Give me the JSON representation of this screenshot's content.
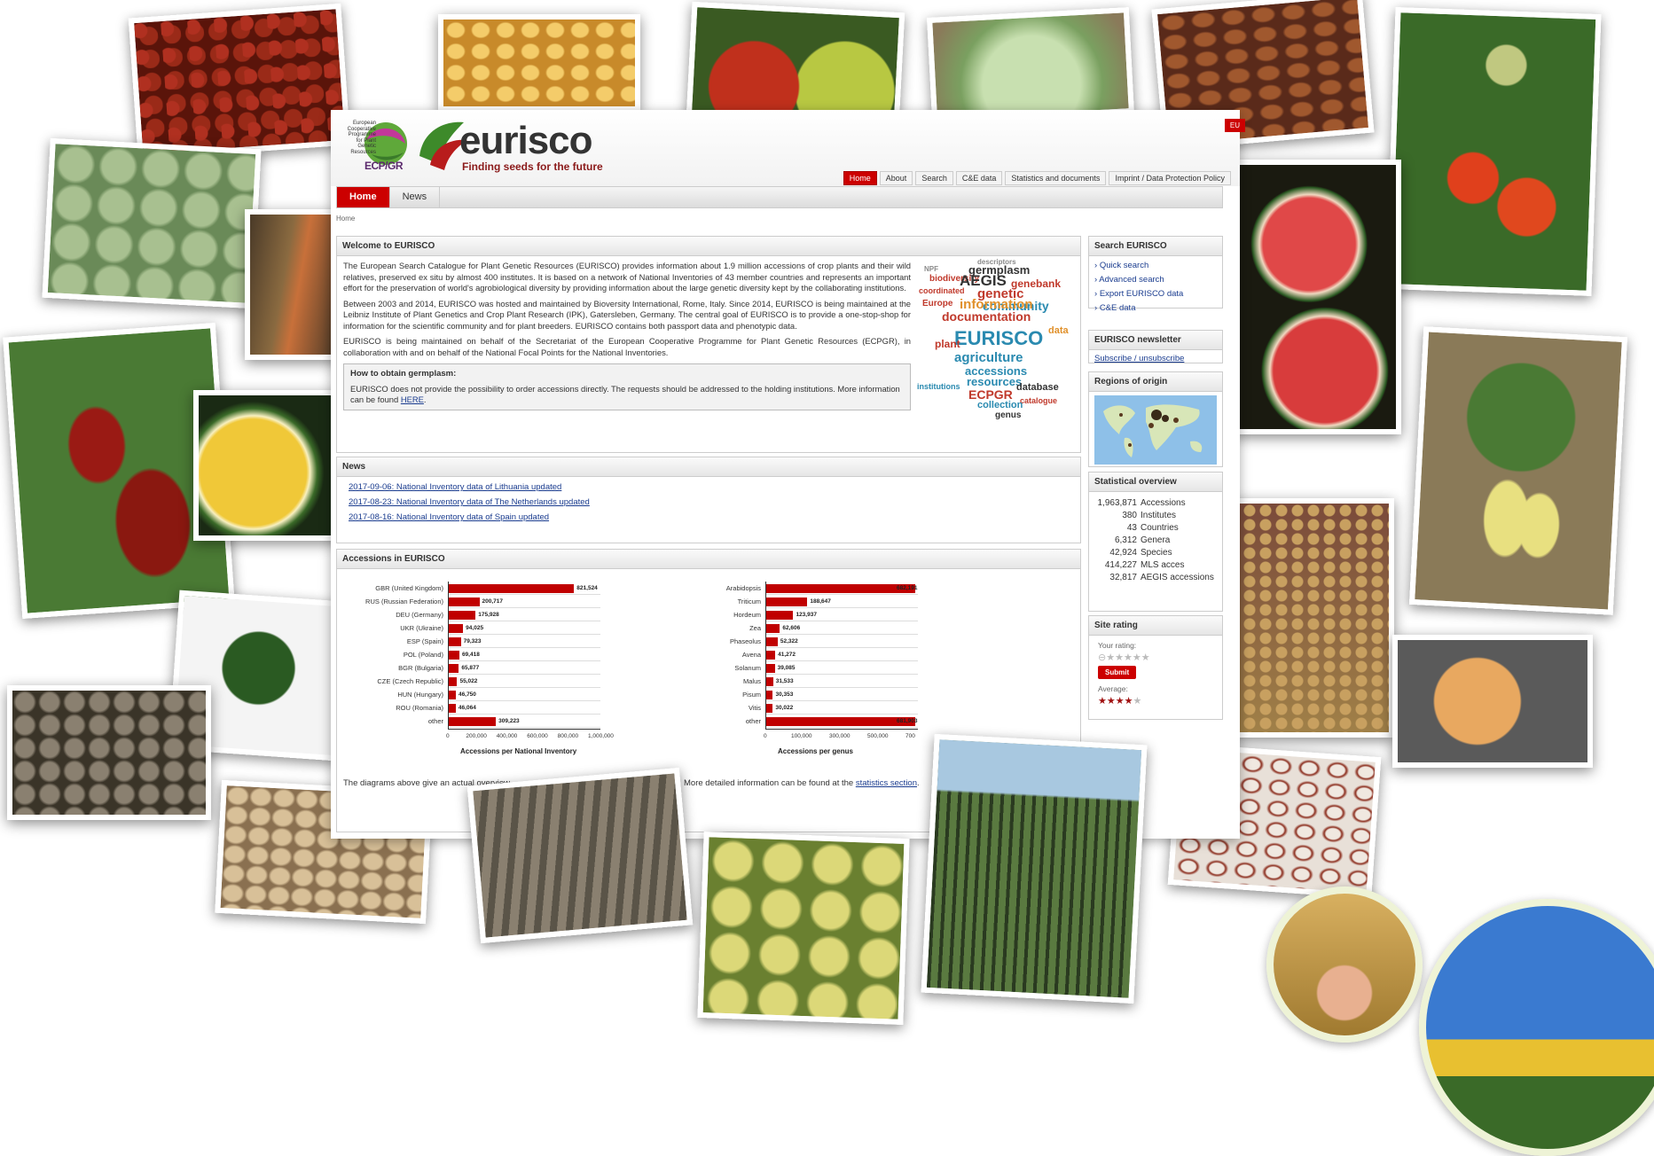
{
  "site": {
    "lang_tab": "EU",
    "ecpgr_lines": [
      "European",
      "Cooperative",
      "Programme",
      "for Plant",
      "Genetic",
      "Resources"
    ],
    "ecpgr_name": "ECP/GR",
    "brand": "eurisco",
    "tagline": "Finding seeds for the future",
    "top_nav": [
      "Home",
      "About",
      "Search",
      "C&E data",
      "Statistics and documents",
      "Imprint / Data Protection Policy"
    ],
    "main_nav": [
      "Home",
      "News"
    ],
    "breadcrumb": "Home"
  },
  "welcome": {
    "title": "Welcome to EURISCO",
    "p1": "The European Search Catalogue for Plant Genetic Resources (EURISCO) provides information about 1.9 million accessions of crop plants and their wild relatives, preserved ex situ by almost 400 institutes. It is based on a network of National Inventories of 43 member countries and represents an important effort for the preservation of world's agrobiological diversity by providing information about the large genetic diversity kept by the collaborating institutions.",
    "p2": "Between 2003 and 2014, EURISCO was hosted and maintained by Bioversity International, Rome, Italy. Since 2014, EURISCO is being maintained at the Leibniz Institute of Plant Genetics and Crop Plant Research (IPK), Gatersleben, Germany. The central goal of EURISCO is to provide a one-stop-shop for information for the scientific community and for plant breeders. EURISCO contains both passport data and phenotypic data.",
    "p3": "EURISCO is being maintained on behalf of the Secretariat of the European Cooperative Programme for Plant Genetic Resources (ECPGR), in collaboration with and on behalf of the National Focal Points for the National Inventories.",
    "howto_title": "How to obtain germplasm:",
    "howto_text": "EURISCO does not provide the possibility to order accessions directly. The requests should be addressed to the holding institutions. More information can be found",
    "howto_link": "HERE",
    "cloud_words": [
      "descriptors",
      "NPF",
      "germplasm",
      "biodiversity",
      "AEGIS",
      "genebank",
      "genetic",
      "community",
      "coordinated",
      "Europe",
      "information",
      "documentation",
      "EURISCO",
      "agriculture",
      "accessions",
      "resources",
      "database",
      "ECPGR",
      "catalogue",
      "collection",
      "genus",
      "institutions",
      "plant",
      "data"
    ]
  },
  "news": {
    "title": "News",
    "items": [
      "2017-09-06: National Inventory data of Lithuania updated",
      "2017-08-23: National Inventory data of The Netherlands updated",
      "2017-08-16: National Inventory data of Spain updated"
    ]
  },
  "accessions": {
    "title": "Accessions in EURISCO",
    "footer_start": "The diagrams above give an actual overview",
    "footer_end": "More detailed information can be found at the",
    "footer_link": "statistics section",
    "footer_period": "."
  },
  "chart_data": [
    {
      "type": "bar",
      "orientation": "horizontal",
      "categories": [
        "GBR (United Kingdom)",
        "RUS (Russian Federation)",
        "DEU (Germany)",
        "UKR (Ukraine)",
        "ESP (Spain)",
        "POL (Poland)",
        "BGR (Bulgaria)",
        "CZE (Czech Republic)",
        "HUN (Hungary)",
        "ROU (Romania)",
        "other"
      ],
      "values": [
        821524,
        200717,
        175928,
        94025,
        79323,
        69418,
        65877,
        55022,
        46750,
        46064,
        309223
      ],
      "value_labels": [
        "821,524",
        "200,717",
        "175,928",
        "94,025",
        "79,323",
        "69,418",
        "65,877",
        "55,022",
        "46,750",
        "46,064",
        "309,223"
      ],
      "xlabel": "Accessions per National Inventory",
      "xlim": [
        0,
        1000000
      ],
      "xticks": [
        "0",
        "200,000",
        "400,000",
        "600,000",
        "800,000",
        "1,000,000"
      ],
      "color": "#c00000"
    },
    {
      "type": "bar",
      "orientation": "horizontal",
      "categories": [
        "Arabidopsis",
        "Triticum",
        "Hordeum",
        "Zea",
        "Phaseolus",
        "Avena",
        "Solanum",
        "Malus",
        "Pisum",
        "Vitis",
        "other"
      ],
      "values": [
        682191,
        188647,
        123937,
        62606,
        52322,
        41272,
        39085,
        31533,
        30353,
        30022,
        681903
      ],
      "value_labels": [
        "682,191",
        "188,647",
        "123,937",
        "62,606",
        "52,322",
        "41,272",
        "39,085",
        "31,533",
        "30,353",
        "30,022",
        "681,903"
      ],
      "xlabel": "Accessions per genus",
      "xlim": [
        0,
        700000
      ],
      "xticks": [
        "0",
        "100,000",
        "300,000",
        "500,000",
        "700"
      ],
      "color": "#c00000"
    }
  ],
  "sidebar": {
    "search_title": "Search EURISCO",
    "search_links": [
      "Quick search",
      "Advanced search",
      "Export EURISCO data",
      "C&E data"
    ],
    "newsletter_title": "EURISCO newsletter",
    "newsletter_link": "Subscribe / unsubscribe",
    "regions_title": "Regions of origin",
    "stats_title": "Statistical overview",
    "stats": [
      {
        "n": "1,963,871",
        "label": "Accessions"
      },
      {
        "n": "380",
        "label": "Institutes"
      },
      {
        "n": "43",
        "label": "Countries"
      },
      {
        "n": "6,312",
        "label": "Genera"
      },
      {
        "n": "42,924",
        "label": "Species"
      },
      {
        "n": "414,227",
        "label": "MLS acces"
      },
      {
        "n": "32,817",
        "label": "AEGIS accessions"
      }
    ],
    "rating_title": "Site rating",
    "your_rating": "Your rating:",
    "submit": "Submit",
    "average": "Average:",
    "average_stars": 4,
    "max_stars": 5
  },
  "photos": [
    {
      "name": "red-maize-kernels-photo",
      "color": "#7a1f10"
    },
    {
      "name": "yellow-maize-kernels-photo",
      "color": "#e8b64a"
    },
    {
      "name": "apples-photo",
      "color": "#8ea83a"
    },
    {
      "name": "cabbage-photo",
      "color": "#9fc08a"
    },
    {
      "name": "beans-photo",
      "color": "#8b4a2a"
    },
    {
      "name": "tomato-plant-photo",
      "color": "#3e6b2a"
    },
    {
      "name": "kohlrabi-photo",
      "color": "#8eac74"
    },
    {
      "name": "carrot-roots-photo",
      "color": "#6a5a3a"
    },
    {
      "name": "watermelon-photo",
      "color": "#b83a3a"
    },
    {
      "name": "red-pepper-photo",
      "color": "#8a2a22"
    },
    {
      "name": "yellow-watermelon-photo",
      "color": "#d9b52a"
    },
    {
      "name": "yellow-pepper-plant-photo",
      "color": "#4f7a32"
    },
    {
      "name": "seedling-photo",
      "color": "#f0f0f0"
    },
    {
      "name": "peanut-plant-photo",
      "color": "#9a7a4a"
    },
    {
      "name": "pumpkin-photo",
      "color": "#6a6a6a"
    },
    {
      "name": "grey-seeds-photo",
      "color": "#7a7060"
    },
    {
      "name": "beige-seeds-photo",
      "color": "#c8b088"
    },
    {
      "name": "parsnip-photo",
      "color": "#7a7468"
    },
    {
      "name": "melon-photo",
      "color": "#8aa03a"
    },
    {
      "name": "millet-field-photo",
      "color": "#4a6a30"
    },
    {
      "name": "spotted-beans-photo",
      "color": "#a05a4a"
    },
    {
      "name": "wheat-hands-photo",
      "color": "#c8a050"
    },
    {
      "name": "sunflower-field-photo",
      "color": "#5a8ac8"
    }
  ]
}
